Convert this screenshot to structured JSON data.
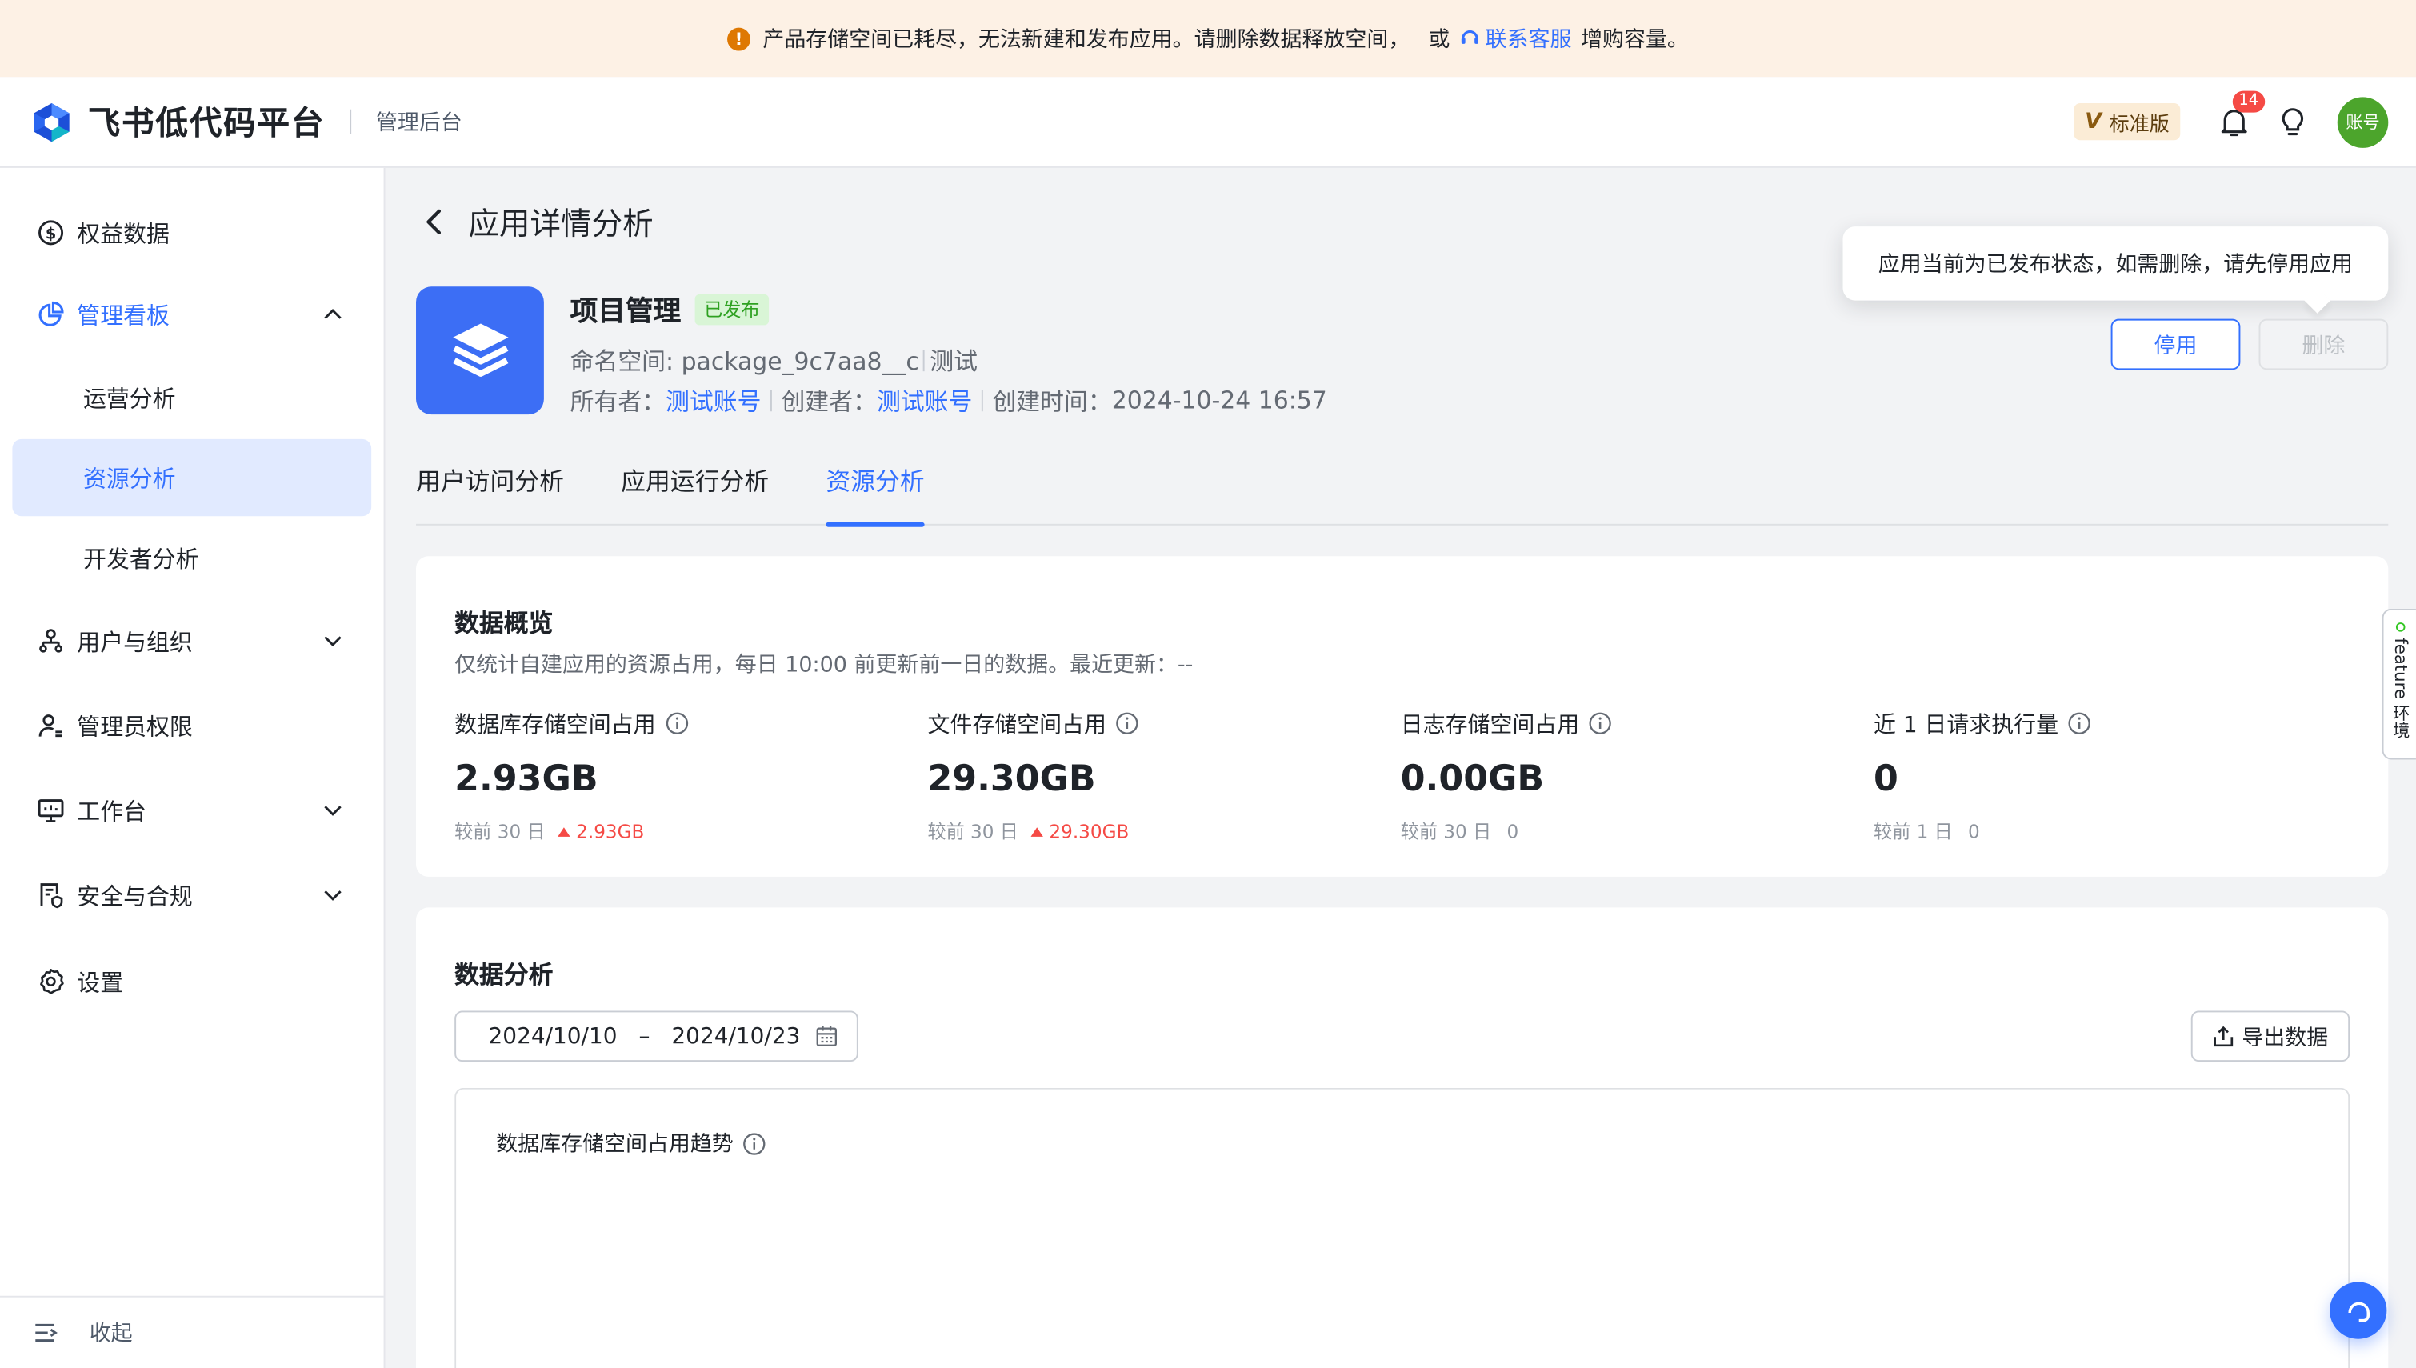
{
  "banner": {
    "text": "产品存储空间已耗尽，无法新建和发布应用。请删除数据释放空间，",
    "or": "或",
    "link": "联系客服",
    "suffix": "增购容量。"
  },
  "header": {
    "logo_text": "飞书低代码平台",
    "subtitle": "管理后台",
    "edition": "标准版",
    "notification_count": "14",
    "avatar": "账号"
  },
  "sidebar": {
    "items": [
      {
        "label": "权益数据",
        "icon": "dollar-circle-icon"
      },
      {
        "label": "管理看板",
        "icon": "pie-chart-icon"
      },
      {
        "label": "运营分析"
      },
      {
        "label": "资源分析"
      },
      {
        "label": "开发者分析"
      },
      {
        "label": "用户与组织",
        "icon": "org-icon"
      },
      {
        "label": "管理员权限",
        "icon": "user-admin-icon"
      },
      {
        "label": "工作台",
        "icon": "monitor-icon"
      },
      {
        "label": "安全与合规",
        "icon": "shield-doc-icon"
      },
      {
        "label": "设置",
        "icon": "gear-icon"
      }
    ],
    "collapse_label": "收起"
  },
  "page": {
    "title": "应用详情分析",
    "app": {
      "name": "项目管理",
      "status": "已发布",
      "namespace_label": "命名空间: package_9c7aa8__c",
      "env": "测试",
      "owner_label": "所有者：",
      "owner": "测试账号",
      "creator_label": "创建者：",
      "creator": "测试账号",
      "created_label": "创建时间：",
      "created_at": "2024-10-24 16:57"
    },
    "tooltip": "应用当前为已发布状态，如需删除，请先停用应用",
    "disable_button": "停用",
    "delete_button": "删除",
    "tabs": [
      "用户访问分析",
      "应用运行分析",
      "资源分析"
    ]
  },
  "overview": {
    "title": "数据概览",
    "desc": "仅统计自建应用的资源占用，每日 10:00 前更新前一日的数据。最近更新：--",
    "stats": [
      {
        "label": "数据库存储空间占用",
        "value": "2.93GB",
        "compare": "较前 30 日",
        "delta": "2.93GB"
      },
      {
        "label": "文件存储空间占用",
        "value": "29.30GB",
        "compare": "较前 30 日",
        "delta": "29.30GB"
      },
      {
        "label": "日志存储空间占用",
        "value": "0.00GB",
        "compare": "较前 30 日",
        "delta": "0"
      },
      {
        "label": "近 1 日请求执行量",
        "value": "0",
        "compare": "较前 1 日",
        "delta": "0"
      }
    ]
  },
  "analysis": {
    "title": "数据分析",
    "start_date": "2024/10/10",
    "end_date": "2024/10/23",
    "range_sep": "–",
    "export_button": "导出数据",
    "chart_title": "数据库存储空间占用趋势"
  },
  "feature_tab": "feature 环境",
  "colors": {
    "accent": "#3370ff",
    "warning": "#de7802",
    "danger": "#f54a45",
    "success": "#2ea121"
  }
}
